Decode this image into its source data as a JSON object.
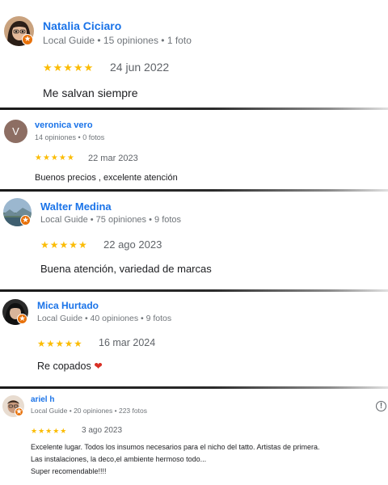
{
  "reviews": [
    {
      "name": "Natalia Ciciaro",
      "meta": "Local Guide • 15 opiniones • 1 foto",
      "stars": "★★★★★",
      "rating": 5,
      "date": "24 jun 2022",
      "text": "Me salvan siempre"
    },
    {
      "name": "veronica vero",
      "avatar_letter": "V",
      "meta": "14 opiniones • 0 fotos",
      "stars": "★★★★★",
      "rating": 5,
      "date": "22 mar 2023",
      "text": "Buenos precios , excelente atención"
    },
    {
      "name": "Walter Medina",
      "meta": "Local Guide • 75 opiniones • 9 fotos",
      "stars": "★★★★★",
      "rating": 5,
      "date": "22 ago 2023",
      "text": "Buena atención, variedad de marcas"
    },
    {
      "name": "Mica Hurtado",
      "meta": "Local Guide • 40 opiniones • 9 fotos",
      "stars": "★★★★★",
      "rating": 5,
      "date": "16 mar 2024",
      "text": "Re copados",
      "emoji": "❤"
    },
    {
      "name": "ariel h",
      "meta": "Local Guide • 20 opiniones • 223 fotos",
      "stars": "★★★★★",
      "rating": 5,
      "date": "3 ago 2023",
      "text_lines": [
        "Excelente lugar. Todos los insumos necesarios para el nicho del tatto. Artistas de primera.",
        "Las instalaciones, la deco,el ambiente hermoso todo...",
        "Super recomendable!!!!"
      ]
    }
  ],
  "colors": {
    "name": "#1a73e8",
    "star": "#fbbc04",
    "guide_badge": "#e8710a"
  },
  "icons": {
    "info": "info-icon",
    "badge": "local-guide-badge-icon"
  }
}
